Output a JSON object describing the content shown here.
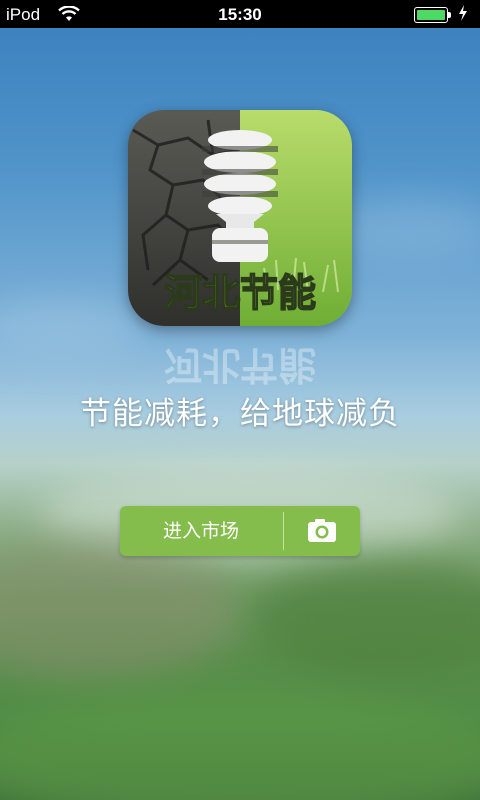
{
  "status_bar": {
    "carrier": "iPod",
    "time": "15:30",
    "wifi_icon": "wifi-icon",
    "battery_icon": "battery-icon",
    "charging_icon": "charging-bolt-icon",
    "battery_color": "#4cd964"
  },
  "app_icon": {
    "name": "河北节能",
    "icon": "energy-saving-bulb-icon"
  },
  "tagline": "节能减耗，给地球减负",
  "actions": {
    "enter_label": "进入市场",
    "camera_icon": "camera-icon",
    "button_color": "#84bd4c"
  }
}
